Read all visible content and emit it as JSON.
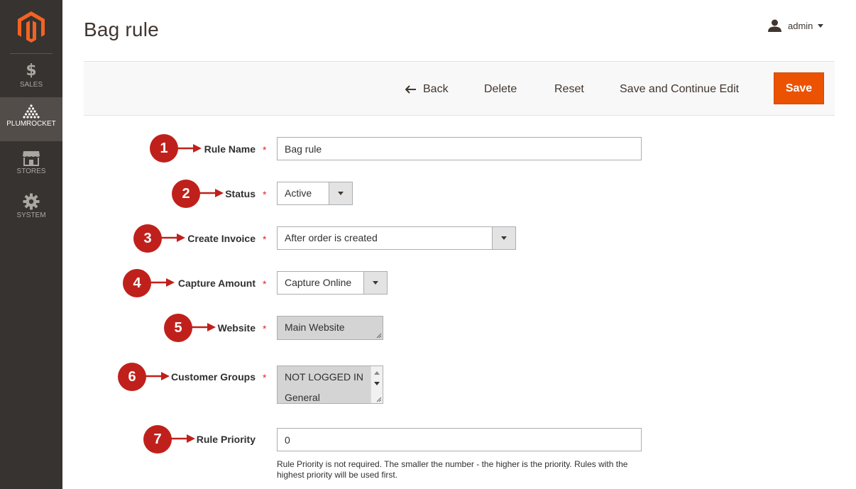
{
  "sidebar": {
    "items": [
      {
        "label": "SALES",
        "icon": "dollar-icon"
      },
      {
        "label": "PLUMROCKET",
        "icon": "plumrocket-icon"
      },
      {
        "label": "STORES",
        "icon": "stores-icon"
      },
      {
        "label": "SYSTEM",
        "icon": "gear-icon"
      }
    ],
    "dollar_glyph": "$"
  },
  "header": {
    "title": "Bag rule",
    "user": "admin"
  },
  "actions": {
    "back": "Back",
    "delete": "Delete",
    "reset": "Reset",
    "save_continue": "Save and Continue Edit",
    "save": "Save"
  },
  "form": {
    "required_mark": "*",
    "rule_name": {
      "label": "Rule Name",
      "value": "Bag rule",
      "badge": "1"
    },
    "status": {
      "label": "Status",
      "value": "Active",
      "badge": "2"
    },
    "create_invoice": {
      "label": "Create Invoice",
      "value": "After order is created",
      "badge": "3"
    },
    "capture_amount": {
      "label": "Capture Amount",
      "value": "Capture Online",
      "badge": "4"
    },
    "website": {
      "label": "Website",
      "options": [
        "Main Website"
      ],
      "badge": "5"
    },
    "customer_groups": {
      "label": "Customer Groups",
      "options": [
        "NOT LOGGED IN",
        "General"
      ],
      "badge": "6"
    },
    "rule_priority": {
      "label": "Rule Priority",
      "value": "0",
      "badge": "7",
      "note": "Rule Priority is not required. The smaller the number - the higher is the priority. Rules with the highest priority will be used first."
    }
  },
  "colors": {
    "sidebar": "#373330",
    "sidebar_active": "#524d49",
    "accent": "#eb5202",
    "badge": "#c0201b",
    "required": "#e22626"
  }
}
